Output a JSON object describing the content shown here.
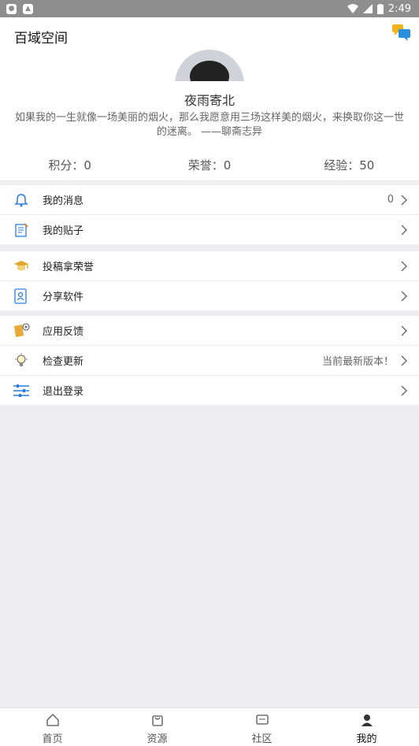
{
  "status_bar": {
    "time": "2:49"
  },
  "header": {
    "title": "百域空间",
    "nickname": "夜雨寄北",
    "motto": "如果我的一生就像一场美丽的烟火，那么我愿意用三场这样美的烟火，来换取你这一世的迷离。 ——聊斋志异"
  },
  "stats": [
    {
      "label": "积分：0"
    },
    {
      "label": "荣誉：0"
    },
    {
      "label": "经验：50"
    }
  ],
  "menu": {
    "group1": [
      {
        "label": "我的消息",
        "value": "0",
        "icon": "bell-icon"
      },
      {
        "label": "我的贴子",
        "value": "",
        "icon": "note-icon"
      }
    ],
    "group2": [
      {
        "label": "投稿拿荣誉",
        "value": "",
        "icon": "graduation-cap-icon"
      },
      {
        "label": "分享软件",
        "value": "",
        "icon": "share-doc-icon"
      }
    ],
    "group3": [
      {
        "label": "应用反馈",
        "value": "",
        "icon": "feedback-icon"
      },
      {
        "label": "检查更新",
        "value": "当前最新版本！",
        "icon": "lightbulb-icon"
      },
      {
        "label": "退出登录",
        "value": "",
        "icon": "sliders-icon"
      }
    ]
  },
  "tabbar": [
    {
      "label": "首页",
      "icon": "home-icon"
    },
    {
      "label": "资源",
      "icon": "bag-icon"
    },
    {
      "label": "社区",
      "icon": "community-icon"
    },
    {
      "label": "我的",
      "icon": "person-icon"
    }
  ],
  "colors": {
    "accent": "#2a7de1",
    "background": "#eeeef2"
  }
}
